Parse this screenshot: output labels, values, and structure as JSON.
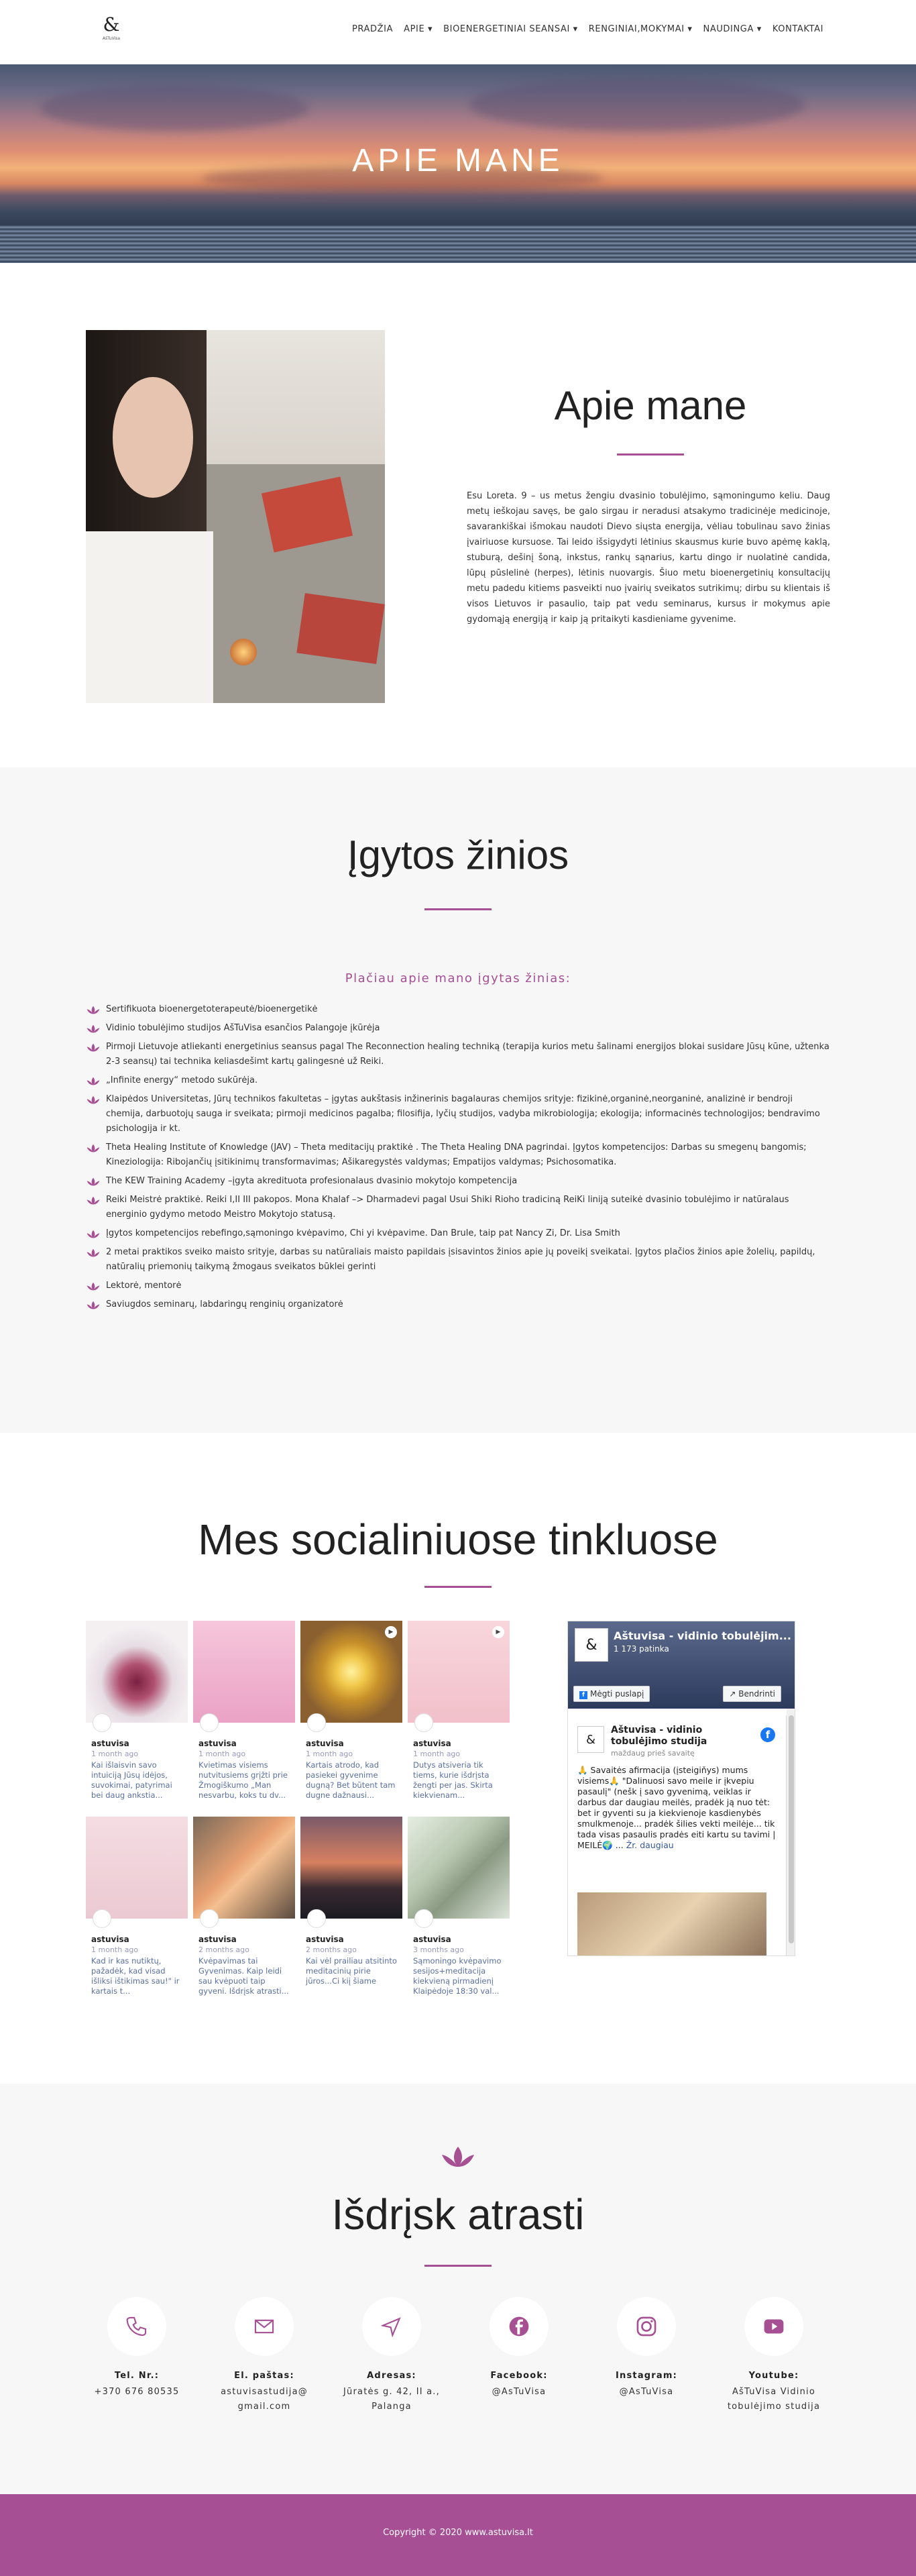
{
  "nav": {
    "logo_mark": "&",
    "logo_sub": "AšTuVisa",
    "items": [
      {
        "label": "PRADŽIA"
      },
      {
        "label": "APIE ▾"
      },
      {
        "label": "BIOENERGETINIAI SEANSAI ▾"
      },
      {
        "label": "RENGINIAI,MOKYMAI ▾"
      },
      {
        "label": "NAUDINGA ▾"
      },
      {
        "label": "KONTAKTAI"
      }
    ]
  },
  "hero": {
    "title": "APIE MANE"
  },
  "about": {
    "title": "Apie mane",
    "text": "Esu Loreta. 9 – us metus žengiu dvasinio tobulėjimo, sąmoningumo keliu. Daug metų ieškojau savęs, be galo sirgau ir neradusi atsakymo tradicinėje medicinoje, savarankiškai išmokau naudoti Dievo siųsta energija, vėliau tobulinau savo žinias įvairiuose kursuose. Tai leido išsigydyti lėtinius skausmus kurie buvo apėmę kaklą, stuburą, dešinį šoną, inkstus, rankų sąnarius, kartu dingo ir nuolatinė candida, lūpų pūslelinė (herpes), lėtinis nuovargis. Šiuo metu bioenergetinių konsultacijų metu padedu kitiems pasveikti nuo įvairių sveikatos sutrikimų; dirbu su klientais iš visos Lietuvos ir pasaulio, taip pat vedu seminarus, kursus ir mokymus apie gydomąją energiją ir kaip ją pritaikyti kasdieniame gyvenime."
  },
  "knowledge": {
    "title": "Įgytos žinios",
    "subtitle": "Plačiau apie mano įgytas žinias:",
    "items": [
      "Sertifikuota bioenergetoterapeutė/bioenergetikė",
      "Vidinio tobulėjimo studijos AšTuVisa esančios Palangoje įkūrėja",
      "Pirmoji Lietuvoje atliekanti energetinius seansus pagal The Reconnection healing techniką (terapija kurios metu šalinami energijos blokai susidare Jūsų kūne, užtenka 2-3 seansų) tai technika keliasdešimt kartų galingesnė už Reiki.",
      "„Infinite energy“ metodo sukūrėja.",
      "Klaipėdos Universitetas, Jūrų technikos fakultetas – įgytas aukštasis inžinerinis bagalauras chemijos srityje: fizikinė,organinė,neorganinė, analizinė ir bendroji chemija, darbuotojų sauga ir sveikata; pirmoji medicinos pagalba; filosifija, lyčių studijos, vadyba mikrobiologija; ekologija; informacinės technologijos; bendravimo psichologija ir kt.",
      "Theta Healing Institute of Knowledge (JAV) – Theta meditacijų praktikė . The Theta Healing DNA pagrindai. Įgytos kompetencijos: Darbas su smegenų bangomis; Kineziologija: Ribojančių įsitikinimų transformavimas; Ašikaregystės valdymas; Empatijos valdymas; Psichosomatika.",
      "The KEW Training Academy –įgyta akredituota profesionalaus dvasinio mokytojo kompetencija",
      "Reiki Meistrė praktikė. Reiki I,II III pakopos. Mona Khalaf –> Dharmadevi pagal Usui Shiki Rioho tradiciną ReiKi liniją suteikė dvasinio tobulėjimo ir natūralaus energinio gydymo metodo Meistro Mokytojo statusą.",
      "Įgytos kompetencijos rebefingo,sąmoningo kvėpavimo, Chi yi kvėpavime. Dan Brule, taip pat Nancy Zi, Dr. Lisa Smith",
      "2 metai praktikos sveiko maisto srityje, darbas su natūraliais maisto papildais įsisavintos žinios apie jų poveikį sveikatai. Įgytos plačios žinios apie žolelių, papildų, natūralių priemonių taikymą žmogaus sveikatos būklei gerinti",
      "Lektorė, mentorė",
      "Saviugdos seminarų, labdaringų renginių organizatorė"
    ]
  },
  "social": {
    "title": "Mes socialiniuose tinkluose",
    "posts": [
      {
        "user": "astuvisa",
        "time": "1 month ago",
        "desc": "Kai išlaisvin savo intuiciją Jūsų idėjos, suvokimai, patyrimai bei daug ankstia...",
        "icon": "image"
      },
      {
        "user": "astuvisa",
        "time": "1 month ago",
        "desc": "Kvietimas visiems nutvitusiems grįžti prie Žmogiškumo „Man nesvarbu, koks tu dv...",
        "icon": "image"
      },
      {
        "user": "astuvisa",
        "time": "1 month ago",
        "desc": "Kartais atrodo, kad pasiekei gyvenime dugną? Bet būtent tam dugne dažnausi...",
        "icon": "video"
      },
      {
        "user": "astuvisa",
        "time": "1 month ago",
        "desc": "Dutys atsiveria tik tiems, kurie išdrįsta žengti per jas. Skirta kiekvienam...",
        "icon": "video"
      },
      {
        "user": "astuvisa",
        "time": "1 month ago",
        "desc": "Kad ir kas nutiktų, pažadėk, kad visad išliksi ištikimas sau!\" ir kartais t...",
        "icon": "image"
      },
      {
        "user": "astuvisa",
        "time": "2 months ago",
        "desc": "Kvėpavimas tai Gyvenimas. Kaip leidi sau kvėpuoti taip gyveni. Išdrįsk atrasti...",
        "icon": "image"
      },
      {
        "user": "astuvisa",
        "time": "2 months ago",
        "desc": "Kai vėl prailiau atsitinto meditacinių pirie jūros...Ci kiį šiame",
        "icon": "image"
      },
      {
        "user": "astuvisa",
        "time": "3 months ago",
        "desc": "Sąmoningo kvėpavimo sesijos+meditacija kiekvieną pirmadienį Klaipėdoje 18:30 val...",
        "icon": "image"
      }
    ],
    "fb": {
      "page_name": "Aštuvisa - vidinio tobulėjim...",
      "likes": "1 173 patinka",
      "like_btn": "Mėgti puslapį",
      "share_btn": "Bendrinti",
      "post_name": "Aštuvisa - vidinio tobulėjimo studija",
      "post_time": "maždaug prieš savaitę",
      "post_text": "🙏 Savaitės afirmacija (įsteigiňys) mums visiems🙏 \"Dalinuosi savo meile ir įkvepiu pasaulį\" (nešk į savo gyvenimą, veiklas ir darbus dar daugiau meilės, pradėk ją nuo tėt: bet ir gyventi su ja kiekvienoje kasdienybės smulkmenoje... pradėk šilies vekti meilėje... tik tada visas pasaulis pradės eiti kartu su tavimi | MEILĖ🌍 ...",
      "post_more": "Žr. daugiau"
    }
  },
  "cta": {
    "title": "Išdrįsk atrasti",
    "contacts": [
      {
        "label": "Tel. Nr.:",
        "value": "+370 676 80535",
        "icon": "phone-icon"
      },
      {
        "label": "El. paštas:",
        "value": "astuvisastudija@ gmail.com",
        "icon": "mail-icon"
      },
      {
        "label": "Adresas:",
        "value": "Jūratės g. 42, II a., Palanga",
        "icon": "location-icon"
      },
      {
        "label": "Facebook:",
        "value": "@AsTuVisa",
        "icon": "facebook-icon"
      },
      {
        "label": "Instagram:",
        "value": "@AsTuVisa",
        "icon": "instagram-icon"
      },
      {
        "label": "Youtube:",
        "value": "AšTuVisa Vidinio tobulėjimo studija",
        "icon": "youtube-icon"
      }
    ]
  },
  "footer": {
    "copyright": "Copyright © 2020 www.astuvisa.lt"
  },
  "colors": {
    "accent": "#a64f93",
    "footer": "#a74f94"
  }
}
